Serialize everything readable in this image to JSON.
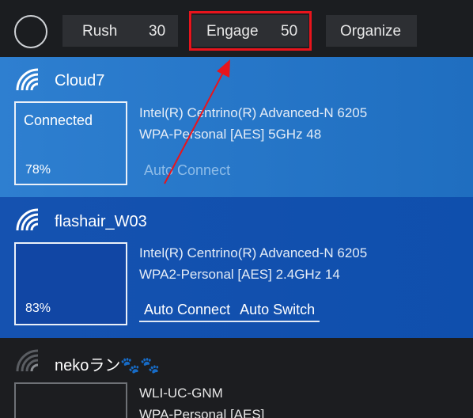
{
  "toolbar": {
    "rush": {
      "label": "Rush",
      "value": "30"
    },
    "engage": {
      "label": "Engage",
      "value": "50"
    },
    "organize": {
      "label": "Organize"
    }
  },
  "networks": [
    {
      "ssid": "Cloud7",
      "status": "Connected",
      "signal": "78%",
      "adapter": "Intel(R) Centrino(R) Advanced-N 6205",
      "security": "WPA-Personal [AES] 5GHz 48",
      "options": [
        "Auto Connect"
      ]
    },
    {
      "ssid": "flashair_W03",
      "status": "",
      "signal": "83%",
      "adapter": "Intel(R) Centrino(R) Advanced-N 6205",
      "security": "WPA2-Personal [AES] 2.4GHz 14",
      "options": [
        "Auto Connect",
        "Auto Switch"
      ]
    },
    {
      "ssid": "nekoラン🐾🐾",
      "status": "",
      "signal": "",
      "adapter": "WLI-UC-GNM",
      "security": "WPA-Personal [AES]",
      "options": []
    }
  ],
  "colors": {
    "highlight": "#e8141c",
    "toolbar_bg": "#1b1d20",
    "connected_bg": "#2e7fd0",
    "selected_bg": "#1552b0"
  }
}
